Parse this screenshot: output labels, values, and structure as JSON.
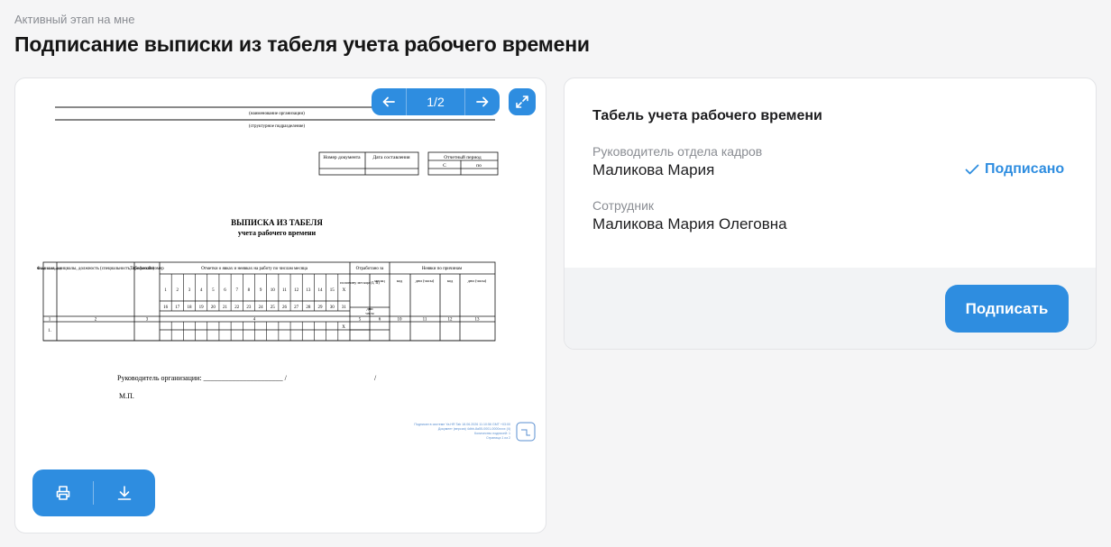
{
  "header": {
    "stage_label": "Активный этап на мне",
    "title": "Подписание выписки из табеля учета рабочего времени"
  },
  "viewer": {
    "page_indicator": "1/2",
    "document": {
      "org_caption": "(наименование организации)",
      "dept_caption": "(структурное подразделение)",
      "doc_number_label": "Номер документа",
      "doc_date_label": "Дата составления",
      "period_label": "Отчетный период",
      "period_from": "С",
      "period_to": "по",
      "heading_1": "ВЫПИСКА ИЗ ТАБЕЛЯ",
      "heading_2": "учета рабочего времени",
      "col_num": "Номер по порядку",
      "col_name": "Фамилия, инициалы, должность (специальность, профессия)",
      "col_tab": "Табельный номер",
      "col_marks": "Отметки о явках и неявках на работу по числам месяца",
      "col_worked": "Отработано за",
      "col_absence": "Неявки по причинам",
      "sub_half": "половину месяца (I, II)",
      "sub_month": "месяц",
      "sub_days": "дни",
      "sub_hours": "часы",
      "sub_code1": "код",
      "sub_dayshours1": "дни (часы)",
      "sub_code2": "код",
      "sub_dayshours2": "дни (часы)",
      "days_row1": [
        "1",
        "2",
        "3",
        "4",
        "5",
        "6",
        "7",
        "8",
        "9",
        "10",
        "11",
        "12",
        "13",
        "14",
        "15",
        "Х"
      ],
      "days_row2": [
        "16",
        "17",
        "18",
        "19",
        "20",
        "21",
        "22",
        "23",
        "24",
        "25",
        "26",
        "27",
        "28",
        "29",
        "30",
        "31"
      ],
      "colnums": [
        "1",
        "2",
        "3",
        "4",
        "5",
        "6",
        "10",
        "11",
        "12",
        "13"
      ],
      "row1_num": "1.",
      "row1_x": "Х",
      "manager_line": "Руководитель организации: ______________________ /",
      "manager_slash": "/",
      "stamp": "М.П.",
      "footer_lines": [
        "Подписан в системе Ya.HR Tab 18.06.2026 11:10:56 GMT +03:00",
        "Документ (версия) 4dbb-8a55-0001-0000xxxx (4)",
        "Количество подписей: 1",
        "Страница 1 из 2"
      ]
    }
  },
  "card": {
    "title": "Табель учета рабочего времени",
    "signer1_role": "Руководитель отдела кадров",
    "signer1_name": "Маликова Мария",
    "signer1_status": "Подписано",
    "signer2_role": "Сотрудник",
    "signer2_name": "Маликова Мария Олеговна",
    "sign_button": "Подписать"
  },
  "colors": {
    "accent": "#2e8de0",
    "background": "#f5f5f6"
  },
  "icons": [
    "arrow-left-icon",
    "arrow-right-icon",
    "expand-icon",
    "print-icon",
    "download-icon",
    "check-icon"
  ]
}
